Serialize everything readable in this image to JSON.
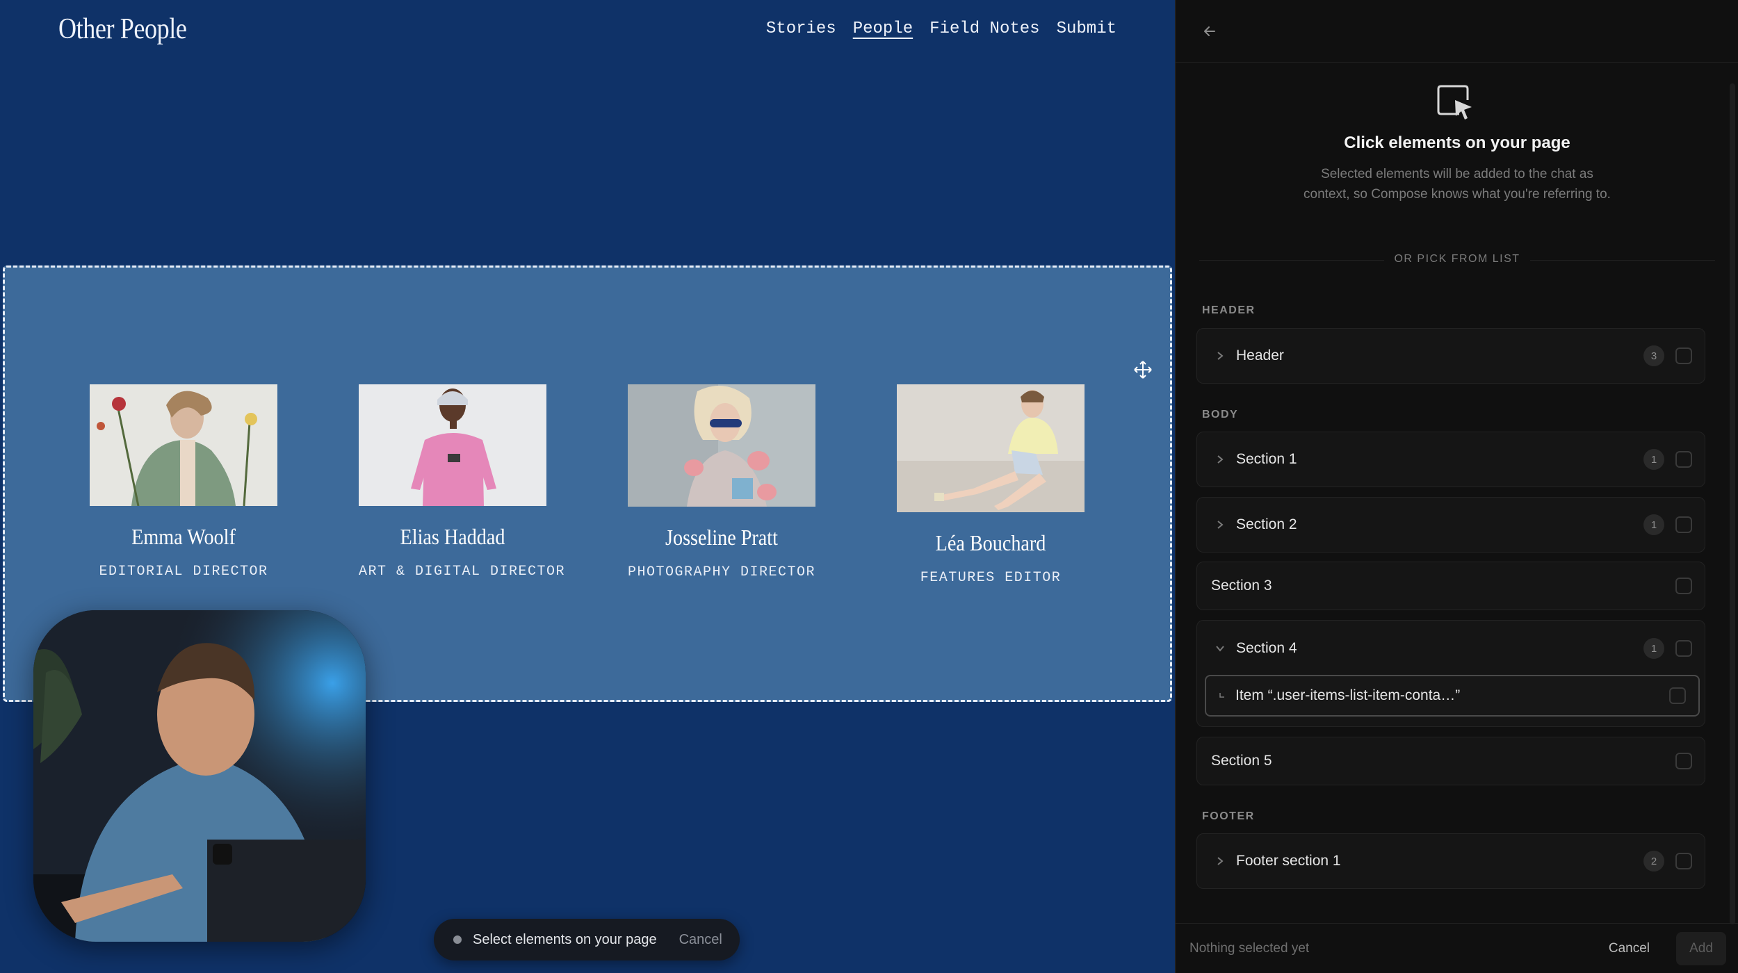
{
  "site": {
    "brand": "Other People",
    "nav": [
      "Stories",
      "People",
      "Field Notes",
      "Submit"
    ],
    "active_nav": "People",
    "people": [
      {
        "name": "Emma Woolf",
        "role": "EDITORIAL DIRECTOR"
      },
      {
        "name": "Elias Haddad",
        "role": "ART & DIGITAL DIRECTOR"
      },
      {
        "name": "Josseline Pratt",
        "role": "PHOTOGRAPHY DIRECTOR"
      },
      {
        "name": "Léa Bouchard",
        "role": "FEATURES EDITOR"
      }
    ]
  },
  "toast": {
    "text": "Select elements on your page",
    "cancel": "Cancel"
  },
  "panel": {
    "title": "Click elements on your page",
    "description": "Selected elements will be added to the chat as context, so Compose knows what you're referring to.",
    "or_pick": "OR PICK FROM LIST",
    "groups": {
      "header": "HEADER",
      "body": "BODY",
      "footer": "FOOTER"
    },
    "rows": {
      "header": {
        "label": "Header",
        "count": "3"
      },
      "section1": {
        "label": "Section 1",
        "count": "1"
      },
      "section2": {
        "label": "Section 2",
        "count": "1"
      },
      "section3": {
        "label": "Section 3"
      },
      "section4": {
        "label": "Section 4",
        "count": "1"
      },
      "section4_item": {
        "label": "Item “.user-items-list-item-conta…”"
      },
      "section5": {
        "label": "Section 5"
      },
      "footer1": {
        "label": "Footer section 1",
        "count": "2"
      }
    },
    "footer": {
      "status": "Nothing selected yet",
      "cancel": "Cancel",
      "add": "Add"
    }
  },
  "icons": {
    "back": "arrow-left-icon",
    "pick": "cursor-select-icon",
    "move": "move-crosshair-icon",
    "chevron_right": "chevron-right-icon",
    "chevron_down": "chevron-down-icon"
  },
  "colors": {
    "site_bg": "#0f3268",
    "selection_bg": "#3d6a9a",
    "panel_bg": "#101010"
  }
}
